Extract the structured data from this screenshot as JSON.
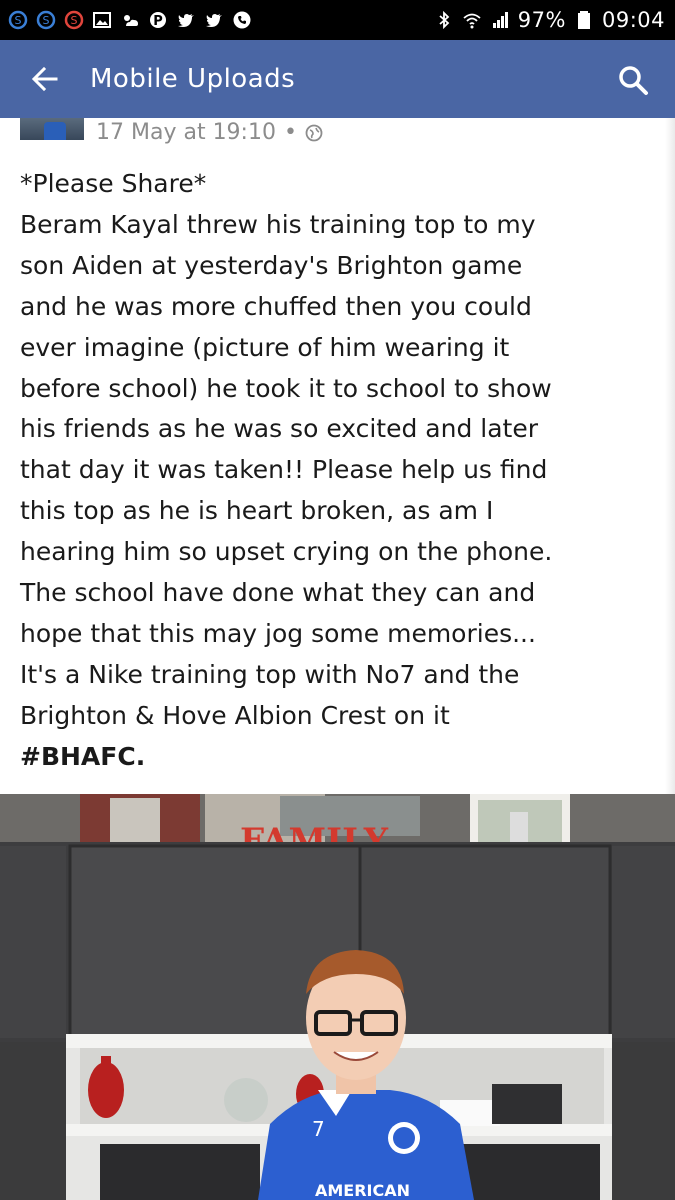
{
  "status_bar": {
    "notification_icons": [
      "s-app-icon",
      "s-app-icon",
      "s-app-icon",
      "image-icon",
      "weather-icon",
      "pinterest-icon",
      "twitter-icon",
      "twitter-icon",
      "phone-icon"
    ],
    "battery_percent": "97%",
    "time": "09:04"
  },
  "app_bar": {
    "title": "Mobile Uploads",
    "color": "#4a66a4"
  },
  "post": {
    "timestamp": "17 May at 19:10",
    "separator": "•",
    "lines": [
      "*Please Share*",
      "Beram Kayal threw his training top to my",
      "son Aiden at yesterday's Brighton game",
      "and he was more chuffed then you could",
      "ever imagine (picture of him wearing it",
      "before school) he took it to school to show",
      "his friends as he was so excited and later",
      "that day it was taken!! Please help us find",
      "this top as he is heart broken, as am I",
      "hearing him so upset crying on the phone.",
      "The school have done what they can and",
      "hope that this may jog some memories...",
      "It's a Nike training top with No7 and the",
      "Brighton & Hove Albion Crest on it"
    ],
    "hashtag": "#BHAFC."
  },
  "photo": {
    "wall_sign_text": "FAMILY",
    "shirt_number": "7",
    "shirt_text": "AMERICAN"
  }
}
